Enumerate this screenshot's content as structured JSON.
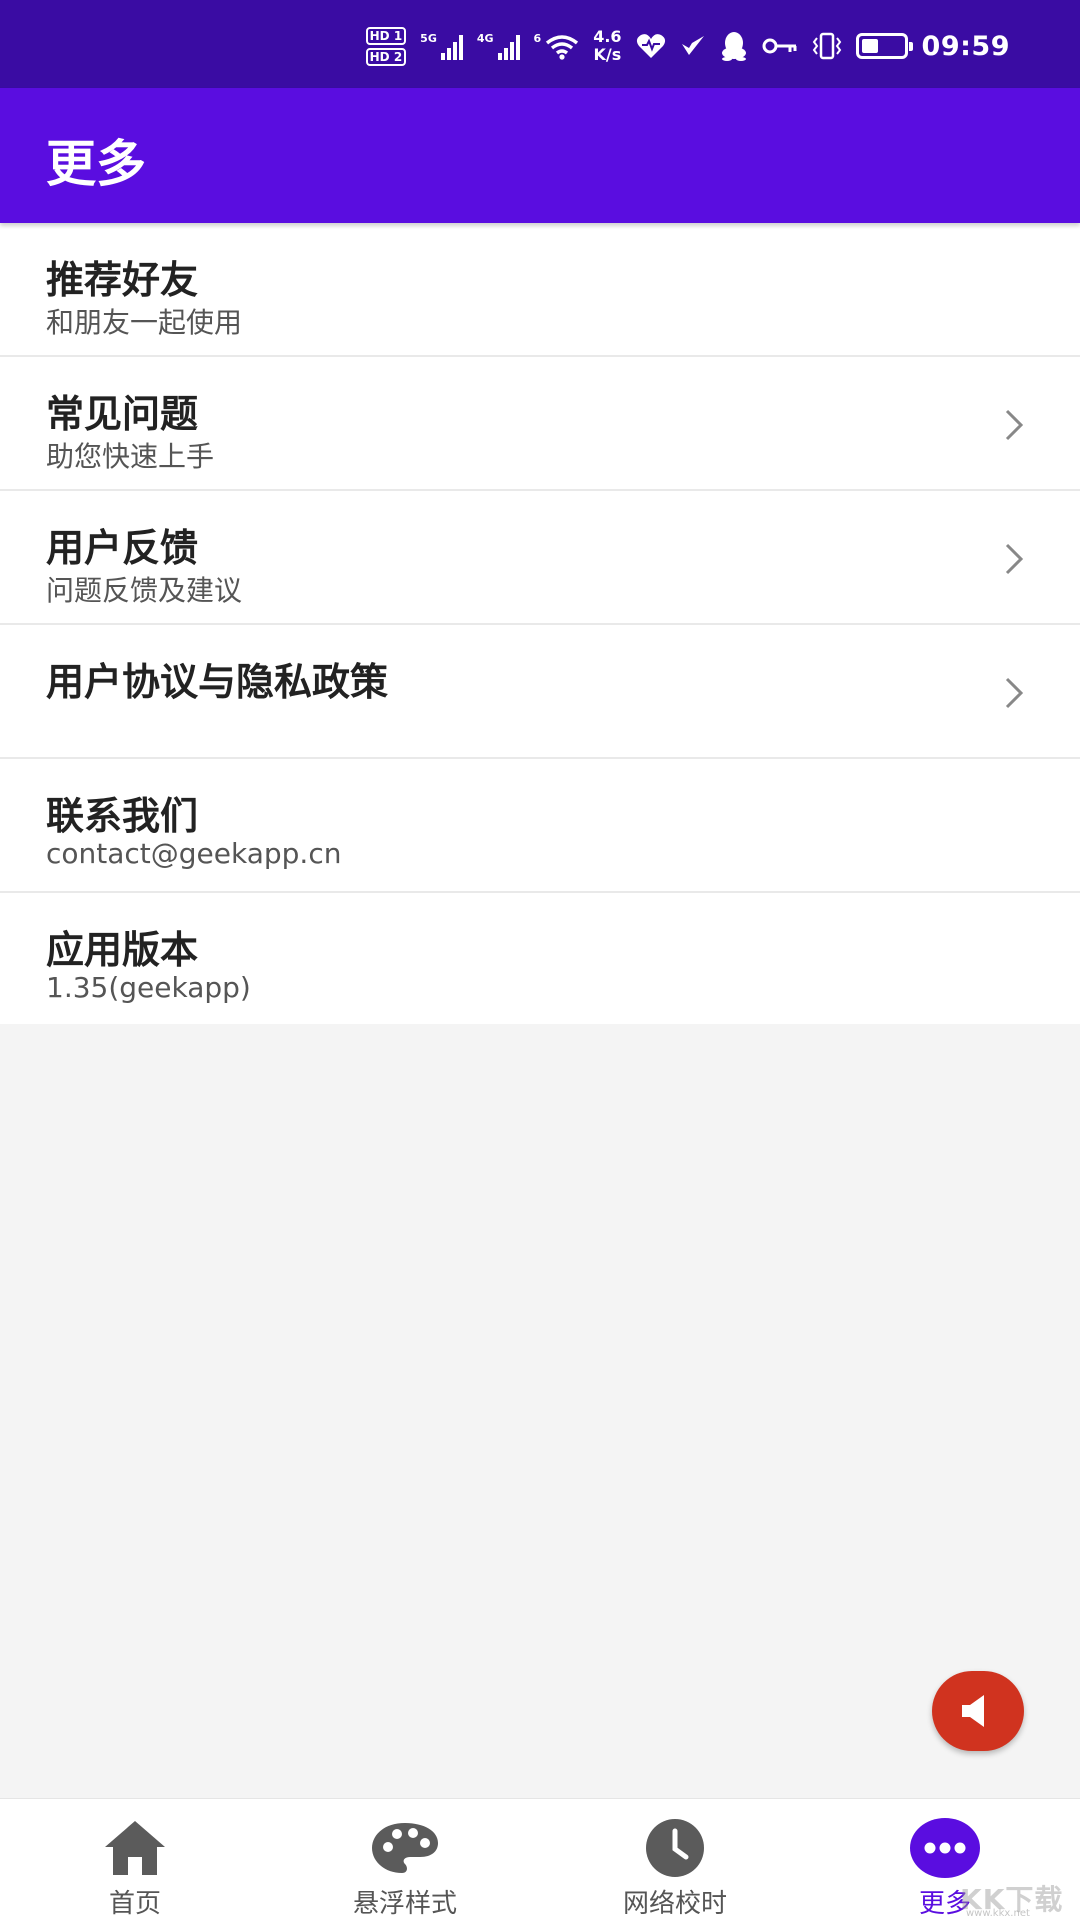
{
  "status_bar": {
    "hd1": "HD 1",
    "hd2": "HD 2",
    "signal1_gen": "5G",
    "signal2_gen": "4G",
    "wifi_gen": "6",
    "speed_value": "4.6",
    "speed_unit": "K/s",
    "battery_percent": 40,
    "time": "09:59"
  },
  "app_bar": {
    "title": "更多"
  },
  "menu": [
    {
      "title": "推荐好友",
      "subtitle": "和朋友一起使用",
      "has_arrow": false
    },
    {
      "title": "常见问题",
      "subtitle": "助您快速上手",
      "has_arrow": true
    },
    {
      "title": "用户反馈",
      "subtitle": "问题反馈及建议",
      "has_arrow": true
    },
    {
      "title": "用户协议与隐私政策",
      "subtitle": "",
      "has_arrow": true
    },
    {
      "title": "联系我们",
      "subtitle": "contact@geekapp.cn",
      "has_arrow": false
    },
    {
      "title": "应用版本",
      "subtitle": "1.35(geekapp)",
      "has_arrow": false
    }
  ],
  "fab": {
    "icon": "speaker-icon",
    "color": "#d0331f"
  },
  "bottom_nav": [
    {
      "label": "首页",
      "icon": "home-icon",
      "active": false
    },
    {
      "label": "悬浮样式",
      "icon": "palette-icon",
      "active": false
    },
    {
      "label": "网络校时",
      "icon": "clock-icon",
      "active": false
    },
    {
      "label": "更多",
      "icon": "more-icon",
      "active": true
    }
  ],
  "watermark": {
    "text": "KK下载",
    "url": "www.kkx.net"
  },
  "colors": {
    "status_bar": "#3a0ca3",
    "app_bar": "#5a0de0",
    "accent": "#5a0de0",
    "inactive_icon": "#555555"
  }
}
